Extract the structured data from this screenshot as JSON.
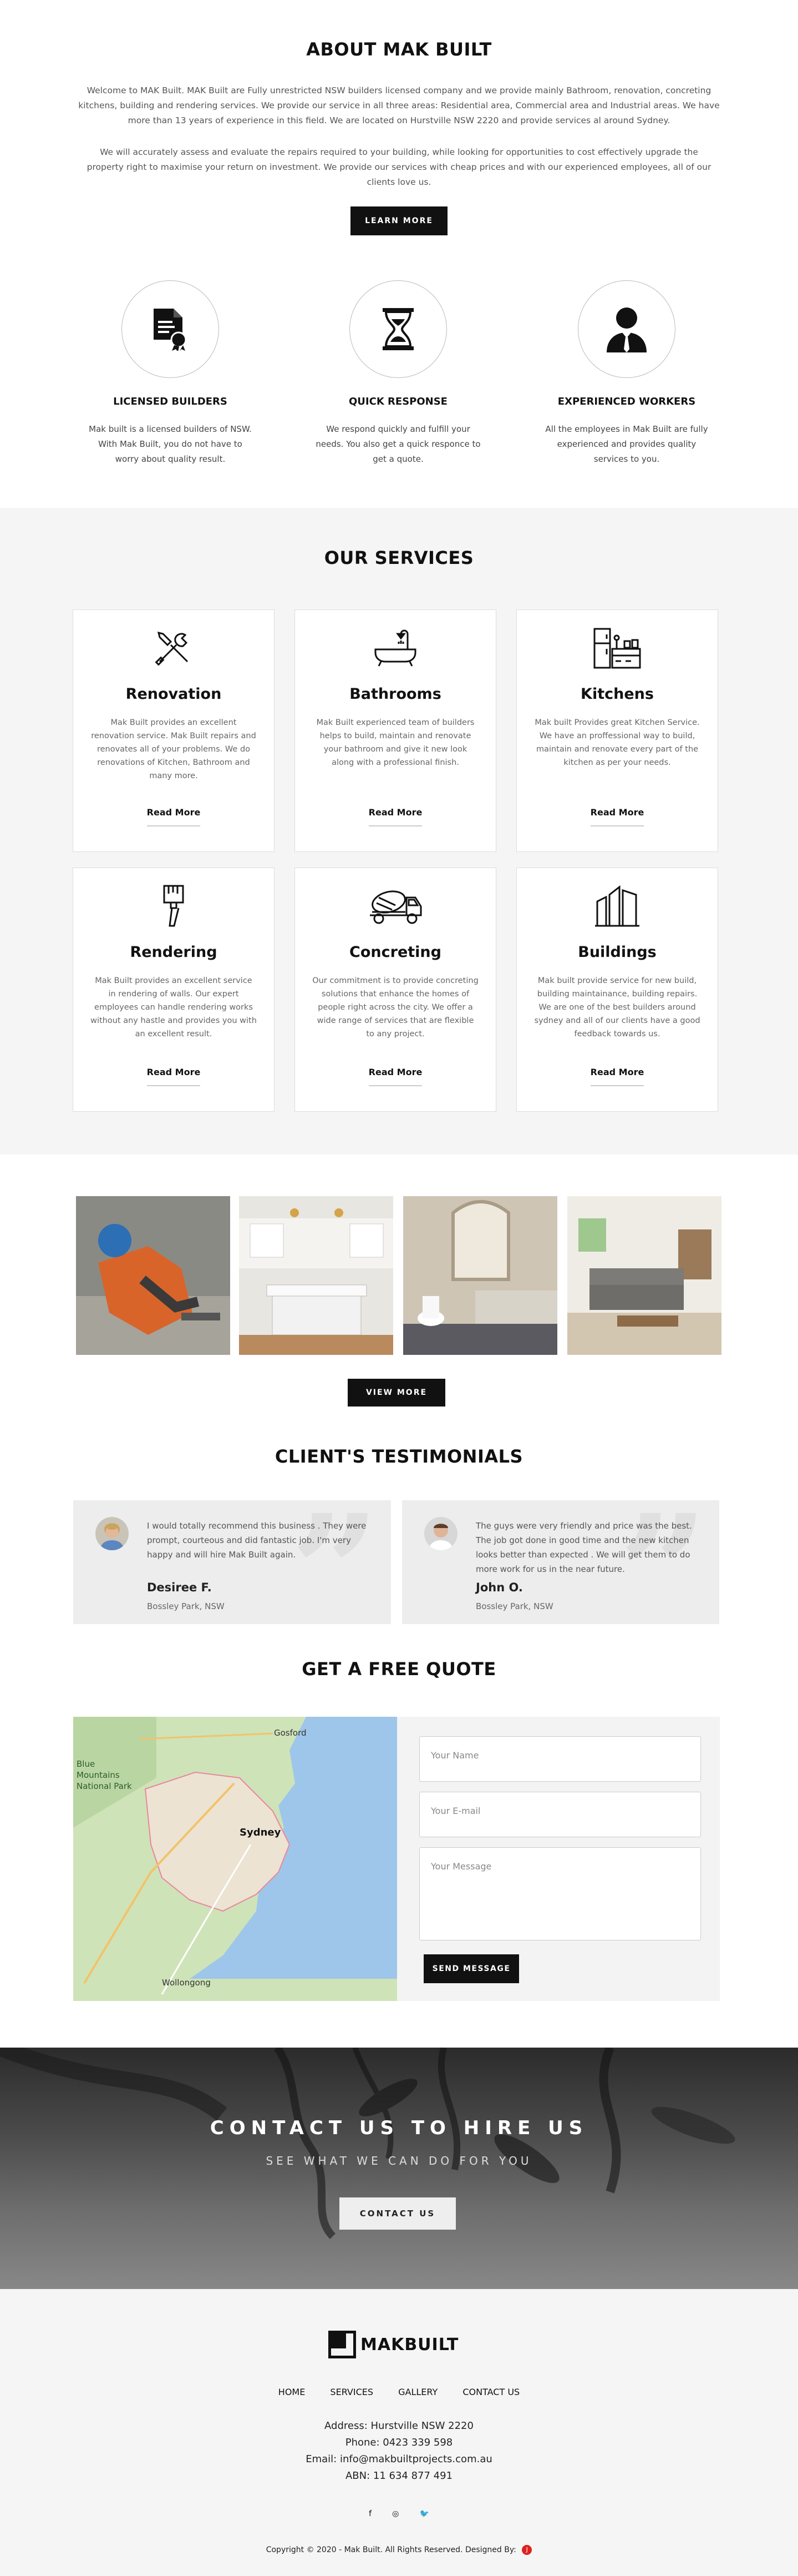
{
  "about": {
    "title": "ABOUT MAK BUILT",
    "para1": "Welcome to MAK Built. MAK Built are Fully unrestricted NSW builders licensed company and we provide mainly Bathroom, renovation, concreting kitchens, building and rendering services. We provide our service in all three areas: Residential area, Commercial area and Industrial areas. We have more than 13 years of experience in this field. We are located on Hurstville NSW 2220 and provide services al around Sydney.",
    "para2": "We will accurately assess and evaluate the repairs required to your building, while looking for opportunities to cost effectively upgrade the property right to maximise your return on investment. We provide our services with cheap prices and with our experienced employees, all of our clients love us.",
    "learn_more": "LEARN MORE",
    "features": [
      {
        "icon": "certificate-icon",
        "title": "LICENSED BUILDERS",
        "text": "Mak built is a licensed builders of NSW. With Mak Built, you do not have to worry about quality result."
      },
      {
        "icon": "hourglass-icon",
        "title": "QUICK RESPONSE",
        "text": "We respond quickly and fulfill your needs. You also get a quick responce to get a quote."
      },
      {
        "icon": "worker-icon",
        "title": "EXPERIENCED WORKERS",
        "text": "All the employees in Mak Built are fully experienced and provides quality services to you."
      }
    ]
  },
  "services": {
    "title": "OUR SERVICES",
    "read_more": "Read More",
    "items": [
      {
        "icon": "tools-icon",
        "title": "Renovation",
        "text": "Mak Built provides an excellent renovation service. Mak Built repairs and renovates all of your problems. We do renovations of Kitchen, Bathroom and many more."
      },
      {
        "icon": "bathtub-icon",
        "title": "Bathrooms",
        "text": "Mak Built experienced team of builders helps to build, maintain and renovate your bathroom and give it new look along with a professional finish."
      },
      {
        "icon": "kitchen-icon",
        "title": "Kitchens",
        "text": "Mak built Provides great Kitchen Service. We have an proffessional way to build, maintain and renovate every part of the kitchen as per your needs."
      },
      {
        "icon": "trowel-icon",
        "title": "Rendering",
        "text": "Mak Built provides an excellent service in rendering of walls. Our expert employees can handle rendering works without any hastle and provides you with an excellent result."
      },
      {
        "icon": "concrete-truck-icon",
        "title": "Concreting",
        "text": "Our commitment is to provide concreting solutions that enhance the homes of people right across the city. We offer a wide range of services that are flexible to any project."
      },
      {
        "icon": "buildings-icon",
        "title": "Buildings",
        "text": "Mak built provide service for new build, building maintainance, building repairs. We are one of the best builders around sydney and all of our clients have a good feedback towards us."
      }
    ]
  },
  "gallery": {
    "view_more": "VIEW MORE",
    "photos": [
      "worker-photo",
      "kitchen-photo",
      "bathroom-photo",
      "living-room-photo"
    ]
  },
  "testimonials": {
    "title": "CLIENT'S TESTIMONIALS",
    "items": [
      {
        "text": "I would totally recommend this business . They were prompt, courteous and did fantastic job. I'm very happy and will hire Mak Built again.",
        "name": "Desiree F.",
        "location": "Bossley Park, NSW"
      },
      {
        "text": "The guys were very friendly and price was the best. The job got done in good time and the new kitchen looks better than expected . We will get them to do more work for us in the near future.",
        "name": "John O.",
        "location": "Bossley Park, NSW"
      }
    ]
  },
  "quote": {
    "title": "GET A FREE QUOTE",
    "map_labels": [
      "Gosford",
      "Blue Mountains National Park",
      "Sydney",
      "Wollongong"
    ],
    "name_placeholder": "Your Name",
    "email_placeholder": "Your E-mail",
    "message_placeholder": "Your Message",
    "send": "SEND MESSAGE"
  },
  "contact_band": {
    "title": "CONTACT US TO HIRE US",
    "subtitle": "SEE WHAT WE CAN DO FOR YOU",
    "button": "CONTACT US"
  },
  "footer": {
    "logo": "MAKBUILT",
    "nav": [
      "HOME",
      "SERVICES",
      "GALLERY",
      "CONTACT US"
    ],
    "address": "Address: Hurstville NSW 2220",
    "phone": "Phone: 0423 339 598",
    "email": "Email: info@makbuiltprojects.com.au",
    "abn": "ABN: 11 634 877 491",
    "social": [
      "facebook-icon",
      "instagram-icon",
      "twitter-icon"
    ],
    "copyright": "Copyright © 2020 - Mak Built. All Rights Reserved. Designed By:"
  }
}
